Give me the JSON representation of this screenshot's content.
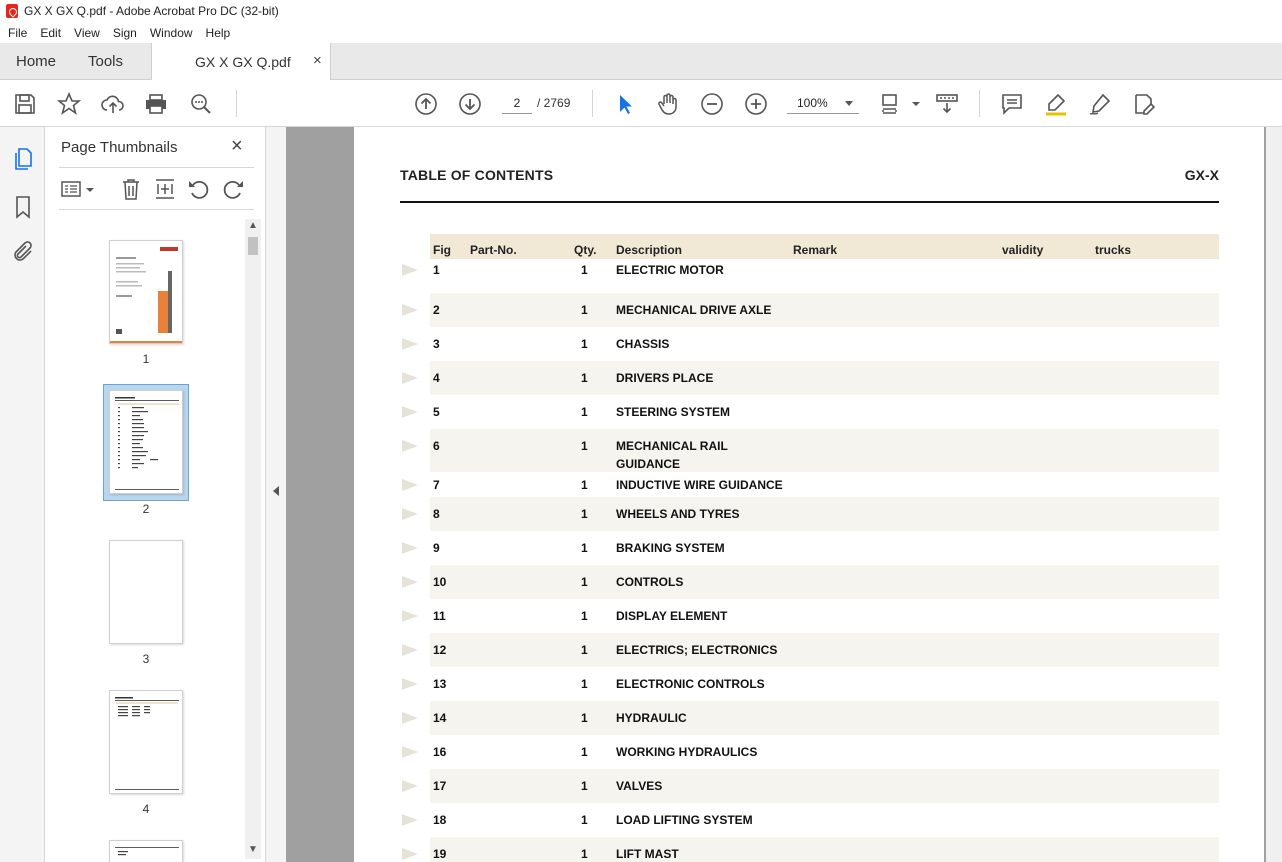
{
  "window": {
    "title": "GX X  GX Q.pdf - Adobe Acrobat Pro DC (32-bit)"
  },
  "menu": [
    "File",
    "Edit",
    "View",
    "Sign",
    "Window",
    "Help"
  ],
  "tabs": {
    "home": "Home",
    "tools": "Tools",
    "doc": "GX X  GX Q.pdf",
    "close": "×"
  },
  "toolbar": {
    "page_current": "2",
    "page_total": "/  2769",
    "zoom": "100%"
  },
  "panel": {
    "title": "Page Thumbnails",
    "close": "×",
    "thumbs": [
      "1",
      "2",
      "3",
      "4"
    ]
  },
  "document": {
    "title": "TABLE OF CONTENTS",
    "model": "GX-X",
    "columns": {
      "fig": "Fig",
      "part": "Part-No.",
      "qty": "Qty.",
      "desc": "Description",
      "remark": "Remark",
      "validity": "validity",
      "trucks": "trucks"
    },
    "rows": [
      {
        "fig": "1",
        "qty": "1",
        "desc": "ELECTRIC MOTOR"
      },
      {
        "fig": "2",
        "qty": "1",
        "desc": "MECHANICAL DRIVE AXLE"
      },
      {
        "fig": "3",
        "qty": "1",
        "desc": "CHASSIS"
      },
      {
        "fig": "4",
        "qty": "1",
        "desc": "DRIVERS PLACE"
      },
      {
        "fig": "5",
        "qty": "1",
        "desc": "STEERING SYSTEM"
      },
      {
        "fig": "6",
        "qty": "1",
        "desc": "MECHANICAL RAIL",
        "desc2": "GUIDANCE"
      },
      {
        "fig": "7",
        "qty": "1",
        "desc": "INDUCTIVE WIRE GUIDANCE"
      },
      {
        "fig": "8",
        "qty": "1",
        "desc": "WHEELS AND TYRES"
      },
      {
        "fig": "9",
        "qty": "1",
        "desc": "BRAKING SYSTEM"
      },
      {
        "fig": "10",
        "qty": "1",
        "desc": "CONTROLS"
      },
      {
        "fig": "11",
        "qty": "1",
        "desc": "DISPLAY ELEMENT"
      },
      {
        "fig": "12",
        "qty": "1",
        "desc": "ELECTRICS; ELECTRONICS"
      },
      {
        "fig": "13",
        "qty": "1",
        "desc": "ELECTRONIC CONTROLS"
      },
      {
        "fig": "14",
        "qty": "1",
        "desc": "HYDRAULIC"
      },
      {
        "fig": "16",
        "qty": "1",
        "desc": "WORKING HYDRAULICS"
      },
      {
        "fig": "17",
        "qty": "1",
        "desc": "VALVES"
      },
      {
        "fig": "18",
        "qty": "1",
        "desc": "LOAD LIFTING SYSTEM"
      },
      {
        "fig": "19",
        "qty": "1",
        "desc": "LIFT MAST"
      }
    ]
  },
  "colors": {
    "accent": "#1473e6",
    "header_bg": "#f1e8d6",
    "row_alt": "#f5f4ef",
    "thumb_selected": "#b8d6ee"
  }
}
